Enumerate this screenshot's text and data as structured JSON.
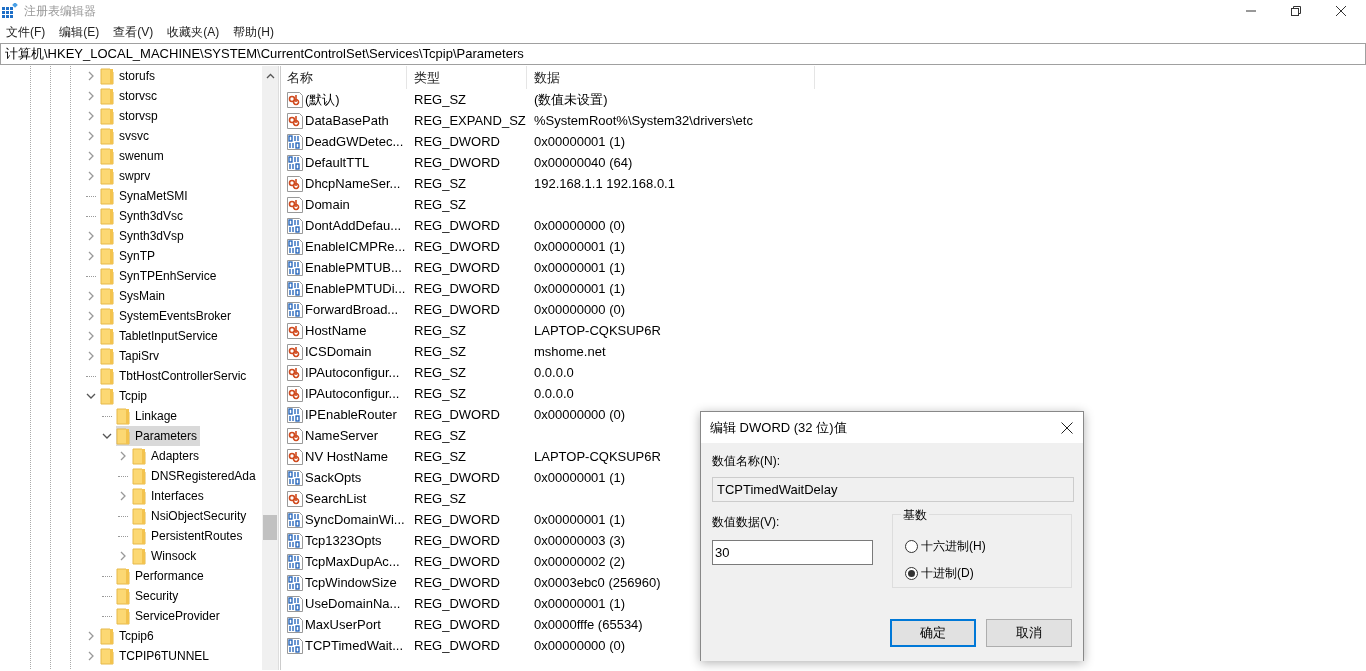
{
  "window": {
    "title": "注册表编辑器"
  },
  "menu": [
    "文件(F)",
    "编辑(E)",
    "查看(V)",
    "收藏夹(A)",
    "帮助(H)"
  ],
  "address": "计算机\\HKEY_LOCAL_MACHINE\\SYSTEM\\CurrentControlSet\\Services\\Tcpip\\Parameters",
  "tree": {
    "items": [
      {
        "name": "storufs",
        "expanded": false,
        "selected": false
      },
      {
        "name": "storvsc",
        "expanded": false,
        "selected": false
      },
      {
        "name": "storvsp",
        "expanded": false,
        "selected": false
      },
      {
        "name": "svsvc",
        "expanded": false,
        "selected": false
      },
      {
        "name": "swenum",
        "expanded": false,
        "selected": false
      },
      {
        "name": "swprv",
        "expanded": false,
        "selected": false
      },
      {
        "name": "SynaMetSMI",
        "selected": false
      },
      {
        "name": "Synth3dVsc",
        "selected": false
      },
      {
        "name": "Synth3dVsp",
        "expanded": false,
        "selected": false
      },
      {
        "name": "SynTP",
        "expanded": false,
        "selected": false
      },
      {
        "name": "SynTPEnhService",
        "selected": false
      },
      {
        "name": "SysMain",
        "expanded": false,
        "selected": false
      },
      {
        "name": "SystemEventsBroker",
        "expanded": false,
        "selected": false
      },
      {
        "name": "TabletInputService",
        "expanded": false,
        "selected": false
      },
      {
        "name": "TapiSrv",
        "expanded": false,
        "selected": false
      },
      {
        "name": "TbtHostControllerServic",
        "selected": false
      },
      {
        "name": "Tcpip",
        "expanded": true,
        "selected": false,
        "children": [
          {
            "name": "Linkage",
            "selected": false
          },
          {
            "name": "Parameters",
            "expanded": true,
            "selected": true,
            "children": [
              {
                "name": "Adapters",
                "expanded": false,
                "selected": false
              },
              {
                "name": "DNSRegisteredAda",
                "selected": false
              },
              {
                "name": "Interfaces",
                "expanded": false,
                "selected": false
              },
              {
                "name": "NsiObjectSecurity",
                "selected": false
              },
              {
                "name": "PersistentRoutes",
                "selected": false
              },
              {
                "name": "Winsock",
                "expanded": false,
                "selected": false
              }
            ]
          },
          {
            "name": "Performance",
            "selected": false
          },
          {
            "name": "Security",
            "selected": false
          },
          {
            "name": "ServiceProvider",
            "selected": false
          }
        ]
      },
      {
        "name": "Tcpip6",
        "expanded": false,
        "selected": false
      },
      {
        "name": "TCPIP6TUNNEL",
        "expanded": false,
        "selected": false
      }
    ]
  },
  "values": {
    "columns": [
      "名称",
      "类型",
      "数据"
    ],
    "rows": [
      {
        "kind": "sz",
        "name": "(默认)",
        "type": "REG_SZ",
        "data": "(数值未设置)"
      },
      {
        "kind": "sz",
        "name": "DataBasePath",
        "type": "REG_EXPAND_SZ",
        "data": "%SystemRoot%\\System32\\drivers\\etc"
      },
      {
        "kind": "dword",
        "name": "DeadGWDetec...",
        "type": "REG_DWORD",
        "data": "0x00000001 (1)"
      },
      {
        "kind": "dword",
        "name": "DefaultTTL",
        "type": "REG_DWORD",
        "data": "0x00000040 (64)"
      },
      {
        "kind": "sz",
        "name": "DhcpNameSer...",
        "type": "REG_SZ",
        "data": "192.168.1.1 192.168.0.1"
      },
      {
        "kind": "sz",
        "name": "Domain",
        "type": "REG_SZ"
      },
      {
        "kind": "dword",
        "name": "DontAddDefau...",
        "type": "REG_DWORD",
        "data": "0x00000000 (0)"
      },
      {
        "kind": "dword",
        "name": "EnableICMPRe...",
        "type": "REG_DWORD",
        "data": "0x00000001 (1)"
      },
      {
        "kind": "dword",
        "name": "EnablePMTUB...",
        "type": "REG_DWORD",
        "data": "0x00000001 (1)"
      },
      {
        "kind": "dword",
        "name": "EnablePMTUDi...",
        "type": "REG_DWORD",
        "data": "0x00000001 (1)"
      },
      {
        "kind": "dword",
        "name": "ForwardBroad...",
        "type": "REG_DWORD",
        "data": "0x00000000 (0)"
      },
      {
        "kind": "sz",
        "name": "HostName",
        "type": "REG_SZ",
        "data": "LAPTOP-CQKSUP6R"
      },
      {
        "kind": "sz",
        "name": "ICSDomain",
        "type": "REG_SZ",
        "data": "mshome.net"
      },
      {
        "kind": "sz",
        "name": "IPAutoconfigur...",
        "type": "REG_SZ",
        "data": "0.0.0.0"
      },
      {
        "kind": "sz",
        "name": "IPAutoconfigur...",
        "type": "REG_SZ",
        "data": "0.0.0.0"
      },
      {
        "kind": "dword",
        "name": "IPEnableRouter",
        "type": "REG_DWORD",
        "data": "0x00000000 (0)"
      },
      {
        "kind": "sz",
        "name": "NameServer",
        "type": "REG_SZ"
      },
      {
        "kind": "sz",
        "name": "NV HostName",
        "type": "REG_SZ",
        "data": "LAPTOP-CQKSUP6R"
      },
      {
        "kind": "dword",
        "name": "SackOpts",
        "type": "REG_DWORD",
        "data": "0x00000001 (1)"
      },
      {
        "kind": "sz",
        "name": "SearchList",
        "type": "REG_SZ"
      },
      {
        "kind": "dword",
        "name": "SyncDomainWi...",
        "type": "REG_DWORD",
        "data": "0x00000001 (1)"
      },
      {
        "kind": "dword",
        "name": "Tcp1323Opts",
        "type": "REG_DWORD",
        "data": "0x00000003 (3)"
      },
      {
        "kind": "dword",
        "name": "TcpMaxDupAc...",
        "type": "REG_DWORD",
        "data": "0x00000002 (2)"
      },
      {
        "kind": "dword",
        "name": "TcpWindowSize",
        "type": "REG_DWORD",
        "data": "0x0003ebc0 (256960)"
      },
      {
        "kind": "dword",
        "name": "UseDomainNa...",
        "type": "REG_DWORD",
        "data": "0x00000001 (1)"
      },
      {
        "kind": "dword",
        "name": "MaxUserPort",
        "type": "REG_DWORD",
        "data": "0x0000fffe (65534)"
      },
      {
        "kind": "dword",
        "name": "TCPTimedWait...",
        "type": "REG_DWORD",
        "data": "0x00000000 (0)"
      }
    ]
  },
  "dialog": {
    "title": "编辑 DWORD (32 位)值",
    "name_label": "数值名称(N):",
    "name_value": "TCPTimedWaitDelay",
    "data_label": "数值数据(V):",
    "data_value": "30",
    "base_label": "基数",
    "radios": [
      {
        "label": "十六进制(H)",
        "selected": false
      },
      {
        "label": "十进制(D)",
        "selected": true
      }
    ],
    "buttons": [
      {
        "label": "确定",
        "default": true
      },
      {
        "label": "取消",
        "default": false
      }
    ]
  }
}
